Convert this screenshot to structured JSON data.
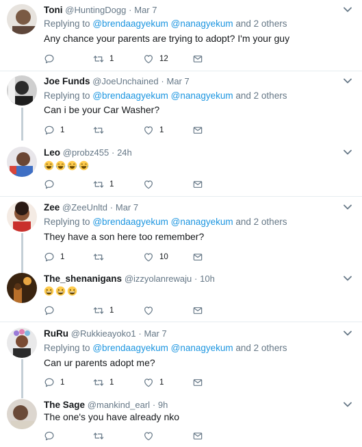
{
  "colors": {
    "name": "#14171a",
    "muted": "#657786",
    "mention": "#1b95e0",
    "divider": "#e6ecf0",
    "thread": "#c4cfd6"
  },
  "reply_prefix": "Replying to",
  "and_others": "and 2 others",
  "tweets": [
    {
      "name": "Toni",
      "handle": "@HuntingDogg",
      "sep": "·",
      "time": "Mar 7",
      "reply_to": [
        "@brendaagyekum",
        "@nanagyekum"
      ],
      "text": "Any chance your parents are trying to adopt? I'm your guy",
      "replies": "",
      "retweets": "1",
      "likes": "12"
    },
    {
      "name": "Joe Funds",
      "handle": "@JoeUnchained",
      "sep": "·",
      "time": "Mar 7",
      "reply_to": [
        "@brendaagyekum",
        "@nanagyekum"
      ],
      "text": "Can i be your Car Washer?",
      "replies": "1",
      "retweets": "",
      "likes": "1"
    },
    {
      "name": "Leo",
      "handle": "@probz455",
      "sep": "·",
      "time": "24h",
      "emojis": [
        "face-with-tears-of-joy",
        "face-with-tears-of-joy",
        "face-with-tears-of-joy",
        "face-with-tears-of-joy"
      ],
      "replies": "",
      "retweets": "1",
      "likes": ""
    },
    {
      "name": "Zee",
      "handle": "@ZeeUnltd",
      "sep": "·",
      "time": "Mar 7",
      "reply_to": [
        "@brendaagyekum",
        "@nanagyekum"
      ],
      "text": "They have a son here too remember?",
      "replies": "1",
      "retweets": "",
      "likes": "10"
    },
    {
      "name": "The_shenanigans",
      "handle": "@izzyolanrewaju",
      "sep": "·",
      "time": "10h",
      "emojis": [
        "grinning-squinting-face",
        "grinning-squinting-face",
        "grinning-squinting-face"
      ],
      "replies": "",
      "retweets": "1",
      "likes": ""
    },
    {
      "name": "RuRu",
      "handle": "@Rukkieayoko1",
      "sep": "·",
      "time": "Mar 7",
      "reply_to": [
        "@brendaagyekum",
        "@nanagyekum"
      ],
      "text": "Can ur parents adopt me?",
      "replies": "1",
      "retweets": "1",
      "likes": "1"
    },
    {
      "name": "The Sage",
      "handle": "@mankind_earl",
      "sep": "·",
      "time": "9h",
      "text": "The one's you have already nko",
      "replies": "",
      "retweets": "",
      "likes": ""
    }
  ]
}
